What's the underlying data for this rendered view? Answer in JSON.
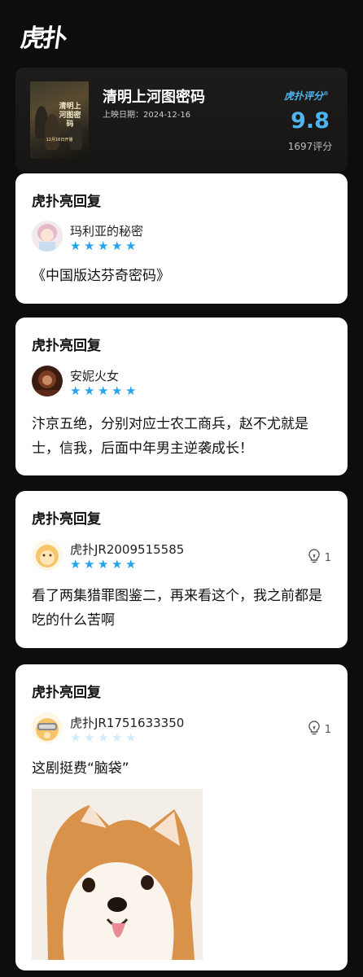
{
  "app": {
    "logo": "虎扑"
  },
  "movie": {
    "title": "清明上河图密码",
    "release": "上映日期：2024-12-16",
    "poster_title": "清明上河图密码",
    "poster_date": "12月16日开播",
    "rating_label": "虎扑评分",
    "rating_mark": "®",
    "score": "9.8",
    "votes": "1697评分"
  },
  "cards": [
    {
      "title": "虎扑亮回复",
      "user": "玛利亚的秘密",
      "stars": 5,
      "text": "《中国版达芬奇密码》",
      "likes": null
    },
    {
      "title": "虎扑亮回复",
      "user": "安妮火女",
      "stars": 5,
      "text": "汴京五绝，分别对应士农工商兵，赵不尤就是士，信我，后面中年男主逆袭成长！",
      "likes": null
    },
    {
      "title": "虎扑亮回复",
      "user": "虎扑JR2009515585",
      "stars": 5,
      "text": "看了两集猎罪图鉴二，再来看这个，我之前都是吃的什么苦啊",
      "likes": "1"
    },
    {
      "title": "虎扑亮回复",
      "user": "虎扑JR1751633350",
      "stars": 0,
      "text": "这剧挺费“脑袋”",
      "likes": "1"
    }
  ],
  "colors": {
    "accent": "#27a3ec",
    "score": "#4db5ef",
    "background": "#0e0d0d"
  },
  "icons": {
    "like": "lightbulb-like-icon",
    "star": "star-icon"
  }
}
